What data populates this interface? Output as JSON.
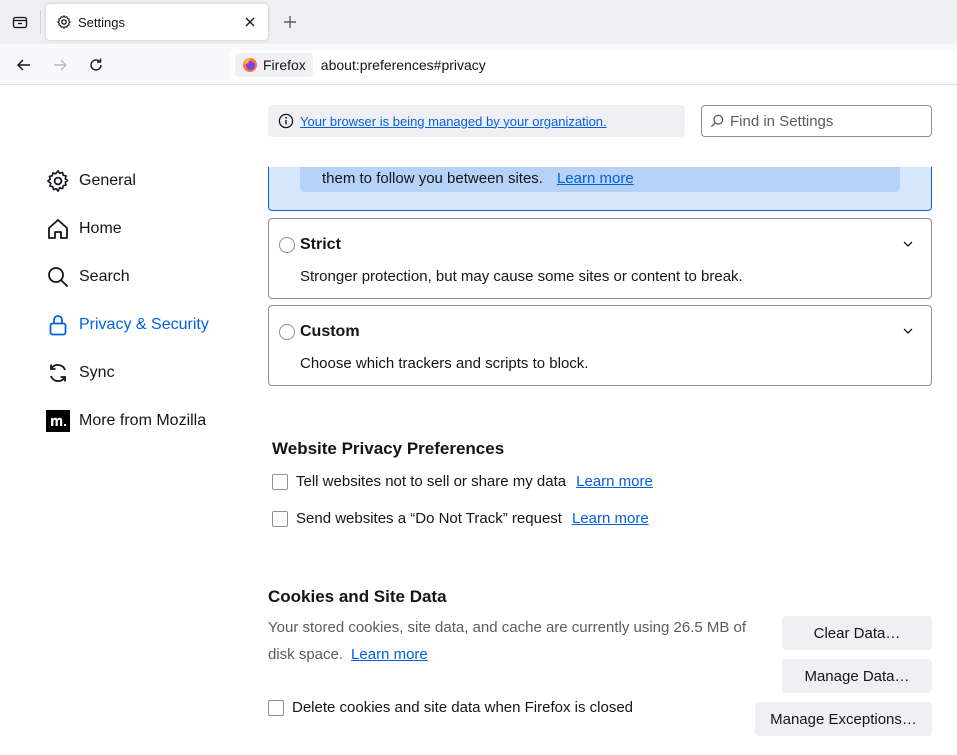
{
  "browser": {
    "tab": {
      "title": "Settings"
    },
    "identity_label": "Firefox",
    "url": "about:preferences#privacy"
  },
  "sidebar": {
    "items": [
      {
        "label": "General",
        "icon": "gear-icon"
      },
      {
        "label": "Home",
        "icon": "home-icon"
      },
      {
        "label": "Search",
        "icon": "search-icon"
      },
      {
        "label": "Privacy & Security",
        "icon": "lock-icon",
        "active": true
      },
      {
        "label": "Sync",
        "icon": "sync-icon"
      },
      {
        "label": "More from Mozilla",
        "icon": "mozilla-icon"
      }
    ]
  },
  "policy_notice": "Your browser is being managed by your organization.",
  "search": {
    "placeholder": "Find in Settings"
  },
  "tracking": {
    "standard_tail": "them to follow you between sites.",
    "standard_link": "Learn more",
    "strict": {
      "title": "Strict",
      "desc": "Stronger protection, but may cause some sites or content to break."
    },
    "custom": {
      "title": "Custom",
      "desc": "Choose which trackers and scripts to block."
    }
  },
  "website_privacy": {
    "title": "Website Privacy Preferences",
    "gpc_label": "Tell websites not to sell or share my data",
    "gpc_link": "Learn more",
    "dnt_label": "Send websites a “Do Not Track” request",
    "dnt_link": "Learn more"
  },
  "cookies": {
    "title": "Cookies and Site Data",
    "desc": "Your stored cookies, site data, and cache are currently using 26.5 MB of disk space.",
    "link": "Learn more",
    "clear_button": "Clear Data…",
    "manage_button": "Manage Data…",
    "exceptions_button": "Manage Exceptions…",
    "delete_on_close_label": "Delete cookies and site data when Firefox is closed"
  },
  "colors": {
    "accent": "#0061e0",
    "tracking_selected_bg": "#d6e6fb"
  }
}
